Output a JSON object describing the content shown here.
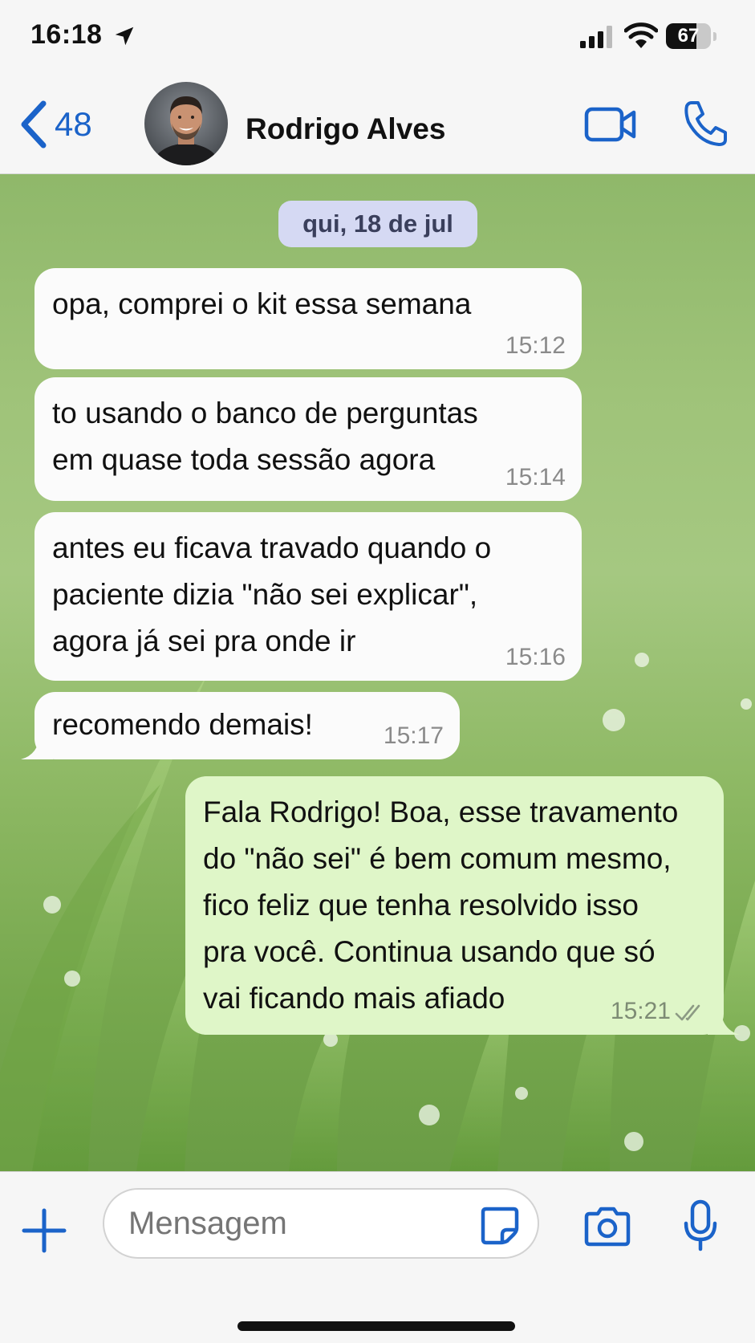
{
  "status_bar": {
    "time": "16:18",
    "icons": [
      "location-arrow-icon",
      "signal-bars-icon",
      "wifi-icon",
      "battery-icon"
    ],
    "battery_level": "67",
    "battery_fraction": 0.67
  },
  "header": {
    "back_count": "48",
    "contact_name": "Rodrigo Alves",
    "icons": [
      "chevron-left-icon",
      "video-camera-icon",
      "phone-icon"
    ],
    "accent_color": "#1b63c9"
  },
  "chat": {
    "date_chip": "qui, 18 de jul",
    "messages": [
      {
        "direction": "incoming",
        "text": "opa, comprei o kit essa semana",
        "time": "15:12"
      },
      {
        "direction": "incoming",
        "text": "to usando o banco de perguntas\nem quase toda sessão agora",
        "time": "15:14"
      },
      {
        "direction": "incoming",
        "text": "antes eu ficava travado quando o\npaciente dizia \"não sei explicar\",\nagora já sei pra onde ir",
        "time": "15:16"
      },
      {
        "direction": "incoming",
        "text": "recomendo demais!",
        "time": "15:17"
      },
      {
        "direction": "outgoing",
        "text": "Fala Rodrigo! Boa, esse travamento\ndo \"não sei\" é bem comum mesmo,\nfico feliz que tenha resolvido isso\npra você. Continua usando que só\nvai ficando mais afiado",
        "time": "15:21",
        "status": "read"
      }
    ],
    "colors": {
      "incoming_bubble": "#fbfbfb",
      "outgoing_bubble": "#dff6c8",
      "date_chip": "#d5d9f3"
    }
  },
  "composer": {
    "placeholder": "Mensagem",
    "icons": [
      "plus-icon",
      "sticker-icon",
      "camera-icon",
      "microphone-icon"
    ]
  }
}
